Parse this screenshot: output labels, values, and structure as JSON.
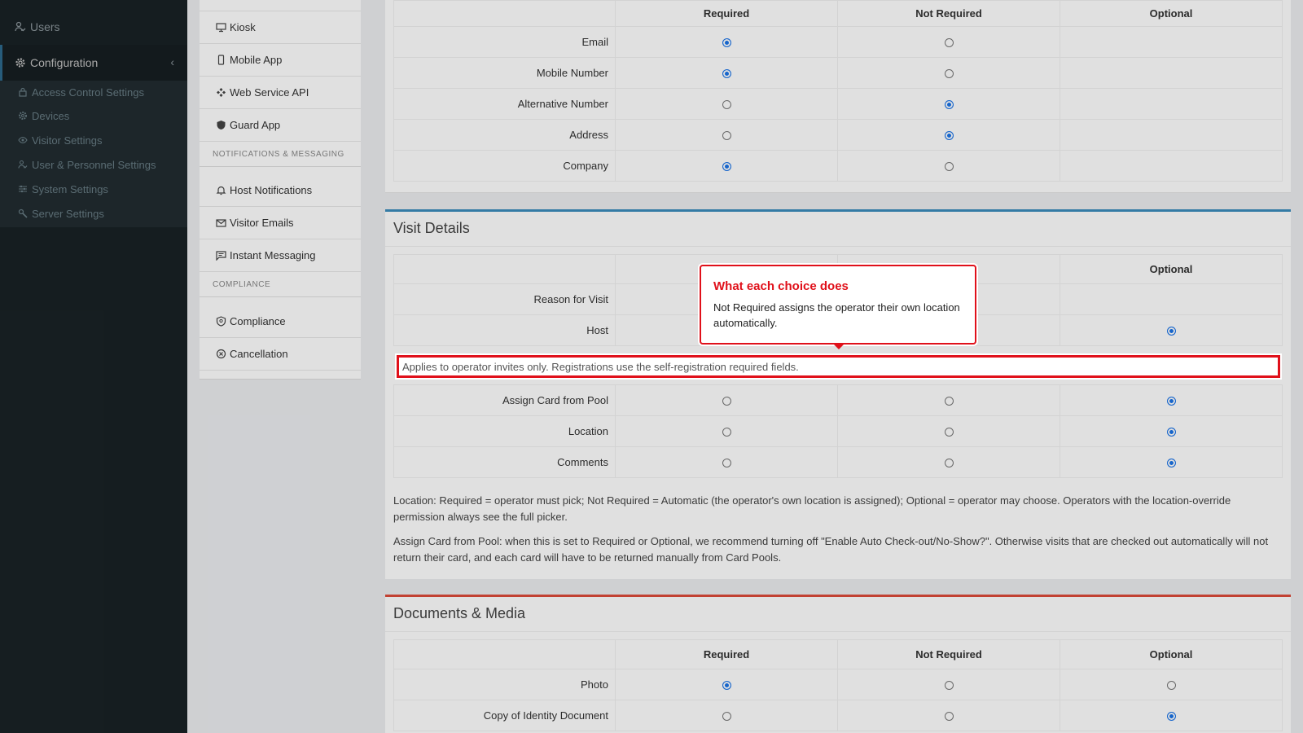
{
  "sidebar": {
    "users_label": "Users",
    "config_label": "Configuration",
    "submenu": [
      {
        "label": "Access Control Settings",
        "icon": "lock-icon"
      },
      {
        "label": "Devices",
        "icon": "gear-icon"
      },
      {
        "label": "Visitor Settings",
        "icon": "eye-icon"
      },
      {
        "label": "User & Personnel Settings",
        "icon": "users-icon"
      },
      {
        "label": "System Settings",
        "icon": "sliders-icon"
      },
      {
        "label": "Server Settings",
        "icon": "wrench-icon"
      }
    ]
  },
  "settings_nav": {
    "items_top": [
      {
        "label": "Kiosk",
        "icon": "monitor-icon"
      },
      {
        "label": "Mobile App",
        "icon": "mobile-icon"
      },
      {
        "label": "Web Service API",
        "icon": "api-icon"
      },
      {
        "label": "Guard App",
        "icon": "shield-icon"
      }
    ],
    "heading_notifications": "Notifications & Messaging",
    "items_notifications": [
      {
        "label": "Host Notifications",
        "icon": "bell-icon"
      },
      {
        "label": "Visitor Emails",
        "icon": "envelope-icon"
      },
      {
        "label": "Instant Messaging",
        "icon": "chat-icon"
      }
    ],
    "heading_compliance": "Compliance",
    "items_compliance": [
      {
        "label": "Compliance",
        "icon": "badge-icon"
      },
      {
        "label": "Cancellation",
        "icon": "cancel-icon"
      }
    ]
  },
  "columns": {
    "required": "Required",
    "not_required": "Not Required",
    "optional": "Optional"
  },
  "contact_rows": [
    {
      "label": "Email",
      "selected": "required"
    },
    {
      "label": "Mobile Number",
      "selected": "required"
    },
    {
      "label": "Alternative Number",
      "selected": "not_required"
    },
    {
      "label": "Address",
      "selected": "not_required"
    },
    {
      "label": "Company",
      "selected": "required"
    }
  ],
  "visit_details": {
    "title": "Visit Details",
    "col_not_required_partial": "d",
    "rows_top": [
      {
        "label": "Reason for Visit"
      },
      {
        "label": "Host",
        "selected": "optional"
      }
    ],
    "rows_bottom": [
      {
        "label": "Assign Card from Pool",
        "selected": "optional"
      },
      {
        "label": "Location",
        "selected": "optional"
      },
      {
        "label": "Comments",
        "selected": "optional"
      }
    ],
    "note_location": "Location: Required = operator must pick; Not Required = Automatic (the operator's own location is assigned); Optional = operator may choose. Operators with the location-override permission always see the full picker.",
    "note_card": "Assign Card from Pool: when this is set to Required or Optional, we recommend turning off \"Enable Auto Check-out/No-Show?\". Otherwise visits that are checked out automatically will not return their card, and each card will have to be returned manually from Card Pools."
  },
  "highlight_text": "Applies to operator invites only. Registrations use the self-registration required fields.",
  "callout": {
    "title": "What each choice does",
    "body": "Not Required assigns the operator their own location automatically."
  },
  "documents": {
    "title": "Documents & Media",
    "rows": [
      {
        "label": "Photo",
        "selected": "required"
      },
      {
        "label": "Copy of Identity Document",
        "selected": "optional"
      }
    ]
  },
  "colors": {
    "visit_border": "#3c8dbc",
    "docs_border": "#dd4b39",
    "highlight": "#e0101a"
  }
}
